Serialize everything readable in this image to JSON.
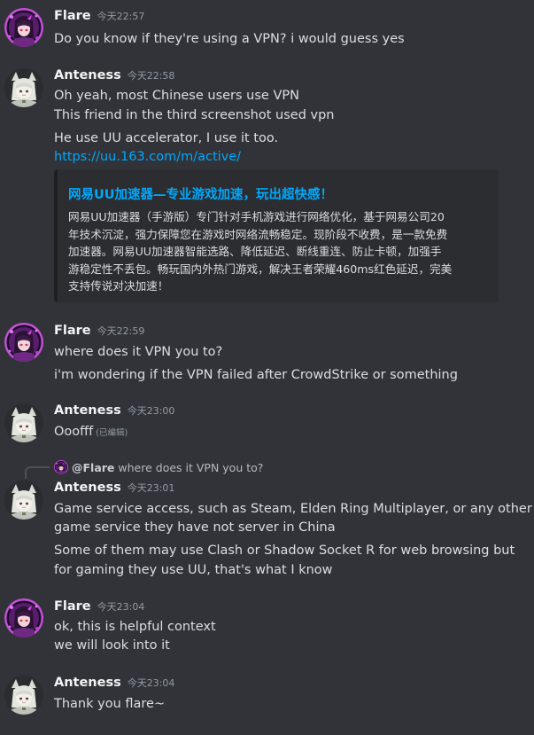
{
  "messages": [
    {
      "author": "Flare",
      "time": "今天22:57",
      "lines": [
        "Do you know if they're using a VPN? i would guess yes"
      ]
    },
    {
      "author": "Anteness",
      "time": "今天22:58",
      "lines": [
        "Oh yeah, most Chinese users use VPN",
        "This friend in the third screenshot used vpn",
        "He use UU accelerator, I use it too."
      ],
      "link": "https://uu.163.com/m/active/",
      "embed": {
        "title": "网易UU加速器—专业游戏加速，玩出超快感！",
        "description": [
          "网易UU加速器（手游版）专门针对手机游戏进行网络优化，基于网易公司20",
          "年技术沉淀，强力保障您在游戏时网络流畅稳定。现阶段不收费，是一款免费",
          "加速器。网易UU加速器智能选路、降低延迟、断线重连、防止卡顿，加强手",
          "游稳定性不丢包。畅玩国内外热门游戏，解决王者荣耀460ms红色延迟，完美",
          "支持传说对决加速！"
        ]
      }
    },
    {
      "author": "Flare",
      "time": "今天22:59",
      "lines": [
        "where does it VPN you to?",
        "i'm wondering if the VPN failed after CrowdStrike or something"
      ]
    },
    {
      "author": "Anteness",
      "time": "今天23:00",
      "lines": [
        "Ooofff"
      ],
      "edited": "(已编辑)"
    },
    {
      "author": "Anteness",
      "time": "今天23:01",
      "reply": {
        "name": "@Flare",
        "text": "where does it VPN you to?"
      },
      "lines": [
        "Game service access, such as Steam, Elden Ring Multiplayer, or any other",
        "game service they have not server in China",
        "Some of them may use Clash or Shadow Socket R for web browsing but",
        "for gaming they use UU, that's what I know"
      ]
    },
    {
      "author": "Flare",
      "time": "今天23:04",
      "lines": [
        "ok, this is helpful context",
        "we will look into it"
      ]
    },
    {
      "author": "Anteness",
      "time": "今天23:04",
      "lines": [
        "Thank you flare~"
      ]
    }
  ],
  "colors": {
    "background": "#313338",
    "text": "#dbdee1",
    "username": "#f2f3f5",
    "timestamp": "#949ba4",
    "link": "#00a8fc",
    "embed_bg": "#2b2d31"
  },
  "icons": {
    "flare_avatar": "flare-avatar-anime-purple",
    "anteness_avatar": "anteness-avatar-anime-cat-ears"
  }
}
